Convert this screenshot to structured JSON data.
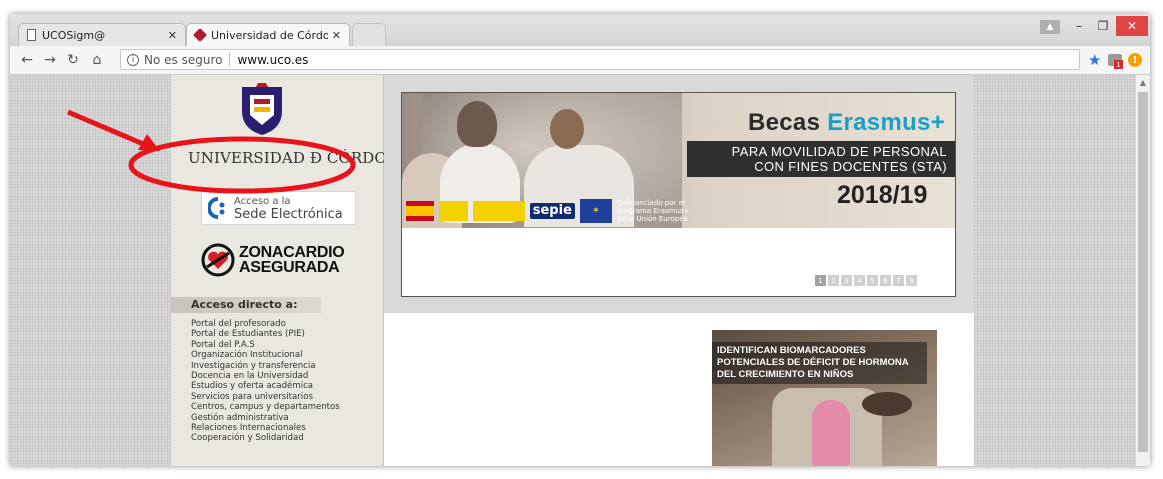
{
  "browser": {
    "tabs": [
      {
        "title": "UCOSigm@"
      },
      {
        "title": "Universidad de Córdoba"
      }
    ],
    "address": {
      "security_text": "No es seguro",
      "url": "www.uco.es"
    }
  },
  "site": {
    "university_name": "UNIVERSIDAD Ð CÓRDOBA",
    "sede": {
      "line1": "Acceso a la",
      "line2": "Sede Electrónica"
    },
    "zona": {
      "line1": "ZONACARDIO",
      "line2": "ASEGURADA"
    },
    "acceso_title": "Acceso directo a:",
    "links": [
      "Portal del profesorado",
      "Portal de Estudiantes (PIE)",
      "Portal del P.A.S",
      "Organización Institucional",
      "Investigación y transferencia",
      "Docencia en la Universidad",
      "Estudios y oferta académica",
      "Servicios para universitarios",
      "Centros, campus y departamentos",
      "Gestión administrativa",
      "Relaciones Internacionales",
      "Cooperación y Solidaridad"
    ],
    "banner": {
      "title_word": "Becas",
      "title_accent": "Erasmus+",
      "subtitle_line1": "PARA MOVILIDAD DE PERSONAL",
      "subtitle_line2": "CON FINES DOCENTES (STA)",
      "year": "2018/19",
      "sepie": "sepie",
      "cofinanciado_line1": "Cofinanciado por el",
      "cofinanciado_line2": "programa Erasmus+",
      "cofinanciado_line3": "de la Unión Europea",
      "pages": [
        "1",
        "2",
        "3",
        "4",
        "5",
        "6",
        "7",
        "8"
      ],
      "active_page": 1
    },
    "news": {
      "caption_line1": "IDENTIFICAN BIOMARCADORES",
      "caption_line2": "POTENCIALES DE DÉFICIT DE HORMONA",
      "caption_line3": "DEL CRECIMIENTO EN NIÑOS"
    }
  },
  "colors": {
    "annotation": "#e8141c",
    "erasmus_accent": "#1aa0c8"
  }
}
